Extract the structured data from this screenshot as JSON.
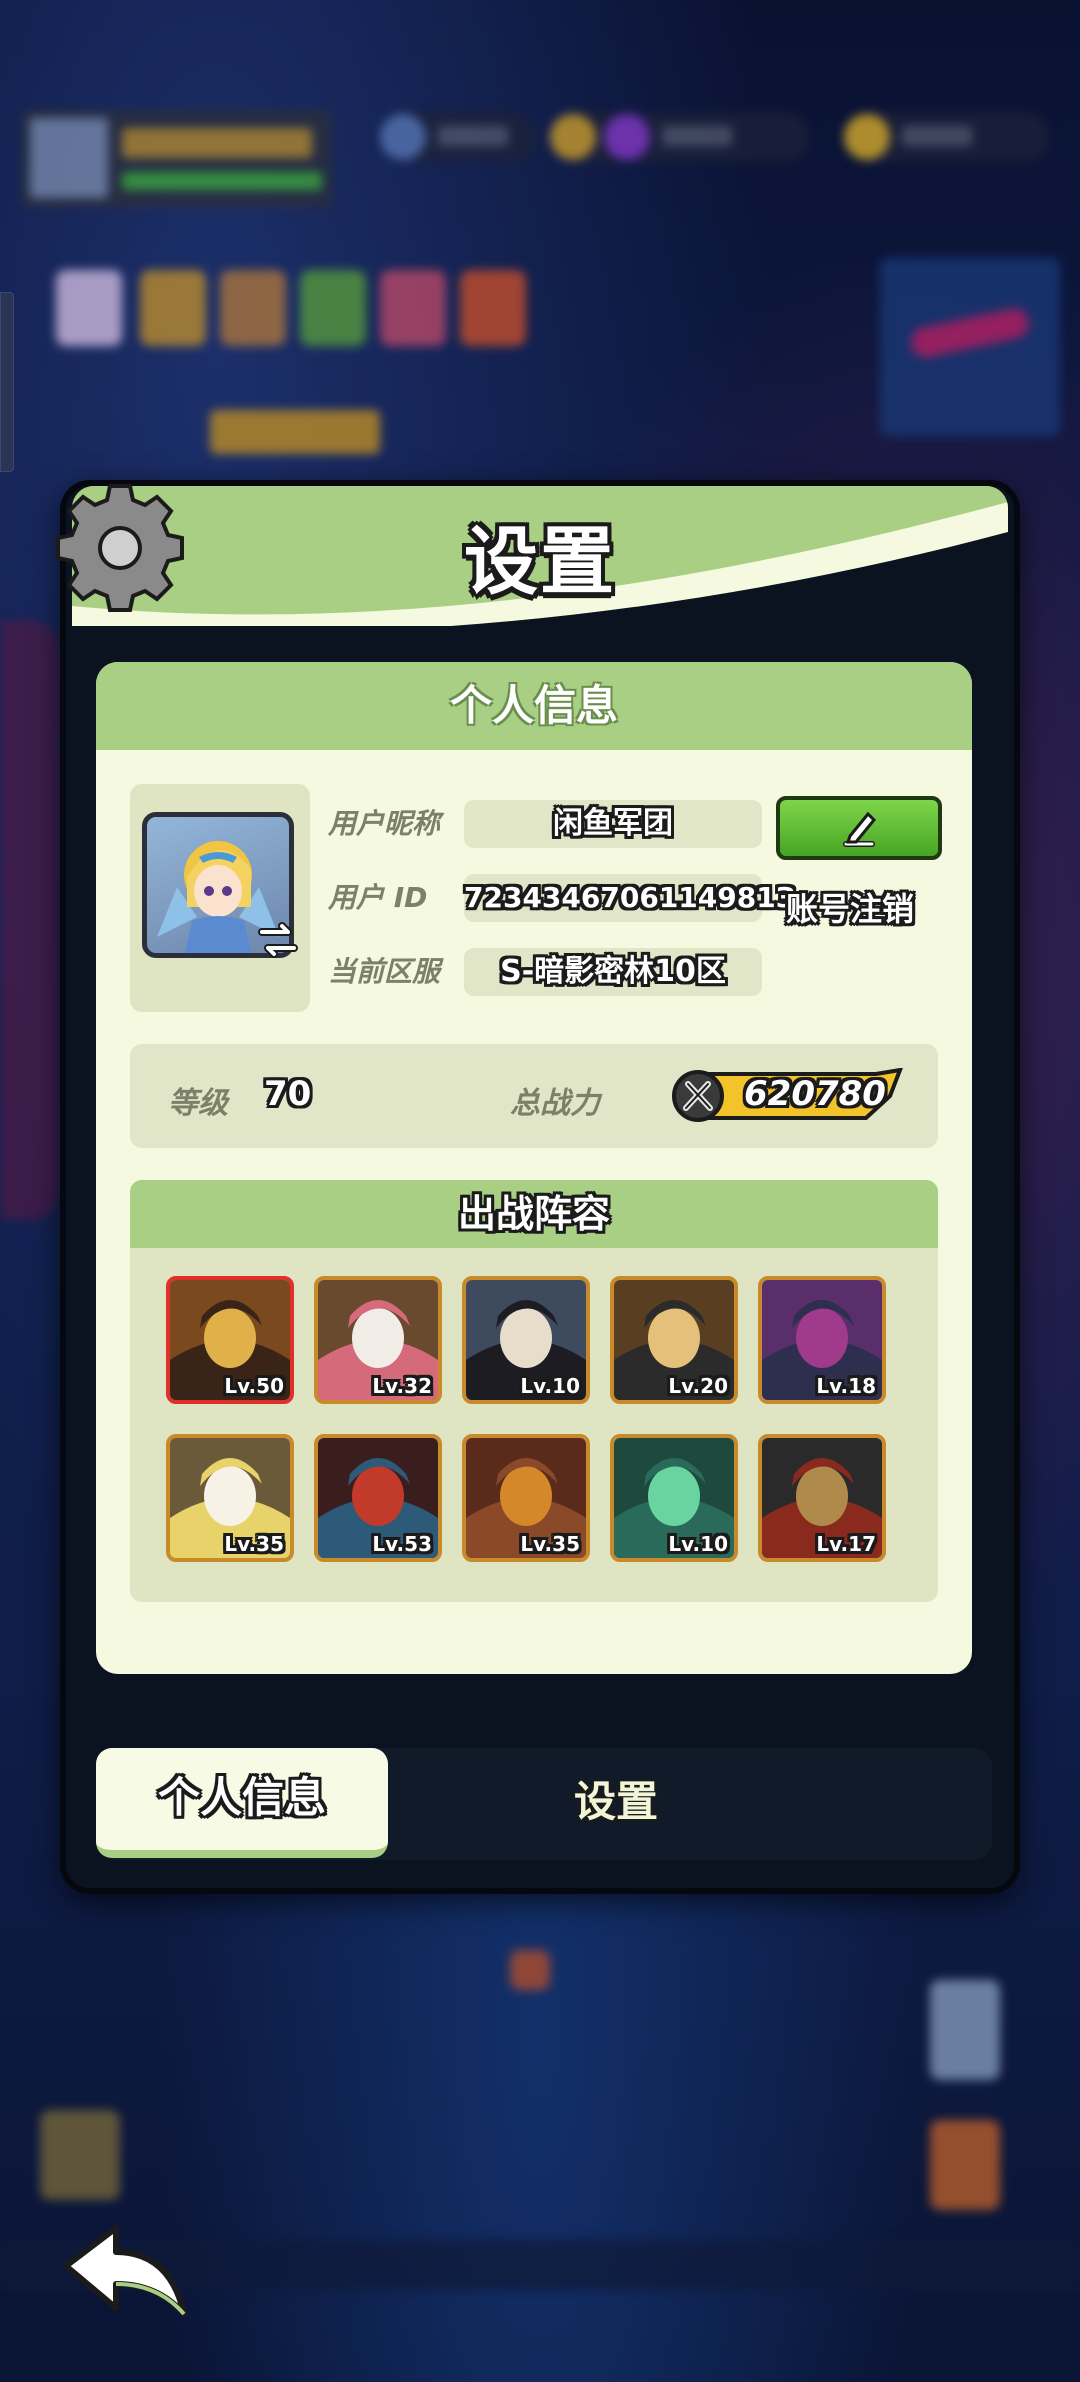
{
  "dialog": {
    "title": "设置"
  },
  "profile": {
    "section_title": "个人信息",
    "nickname_label": "用户昵称",
    "nickname": "闲鱼军团",
    "id_label": "用户  ID",
    "user_id": "7234346706114981З",
    "cancel_account": "账号注销",
    "server_label": "当前区服",
    "server": "S-暗影密林10区"
  },
  "stats": {
    "level_label": "等级",
    "level": "70",
    "power_label": "总战力",
    "power": "620780"
  },
  "lineup": {
    "title": "出战阵容",
    "heroes": [
      {
        "level": "Lv.50",
        "frame": "red",
        "palette": [
          "#7a4a1e",
          "#e0b049",
          "#3a2418"
        ]
      },
      {
        "level": "Lv.32",
        "frame": "gold",
        "palette": [
          "#6a4a2e",
          "#f2ece6",
          "#d46a7a"
        ]
      },
      {
        "level": "Lv.10",
        "frame": "gold",
        "palette": [
          "#3e4b5e",
          "#e8dccb",
          "#1c1c22"
        ]
      },
      {
        "level": "Lv.20",
        "frame": "gold",
        "palette": [
          "#5a3e22",
          "#e4c07a",
          "#2b2b2b"
        ]
      },
      {
        "level": "Lv.18",
        "frame": "gold",
        "palette": [
          "#5a2e6a",
          "#a03a8a",
          "#2e2e4e"
        ]
      },
      {
        "level": "Lv.35",
        "frame": "gold",
        "palette": [
          "#6a5a3a",
          "#f6f2e6",
          "#e8d36a"
        ]
      },
      {
        "level": "Lv.53",
        "frame": "gold",
        "palette": [
          "#3a1e1e",
          "#c23a2a",
          "#2e5a7a"
        ]
      },
      {
        "level": "Lv.35",
        "frame": "gold",
        "palette": [
          "#5a2a1a",
          "#d4882a",
          "#8a4a2a"
        ]
      },
      {
        "level": "Lv.10",
        "frame": "gold",
        "palette": [
          "#1e4a3e",
          "#6ad4a0",
          "#2a6a5a"
        ]
      },
      {
        "level": "Lv.17",
        "frame": "gold",
        "palette": [
          "#2a2a2a",
          "#b08a4a",
          "#8a2a1e"
        ]
      }
    ]
  },
  "tabs": {
    "profile": "个人信息",
    "settings": "设置"
  },
  "colors": {
    "header_green": "#a8cf83",
    "panel_cream": "#f4f9df",
    "edit_green": "#47a523",
    "hero_frame_gold": "#c88a2a",
    "hero_frame_red": "#e0302c"
  }
}
